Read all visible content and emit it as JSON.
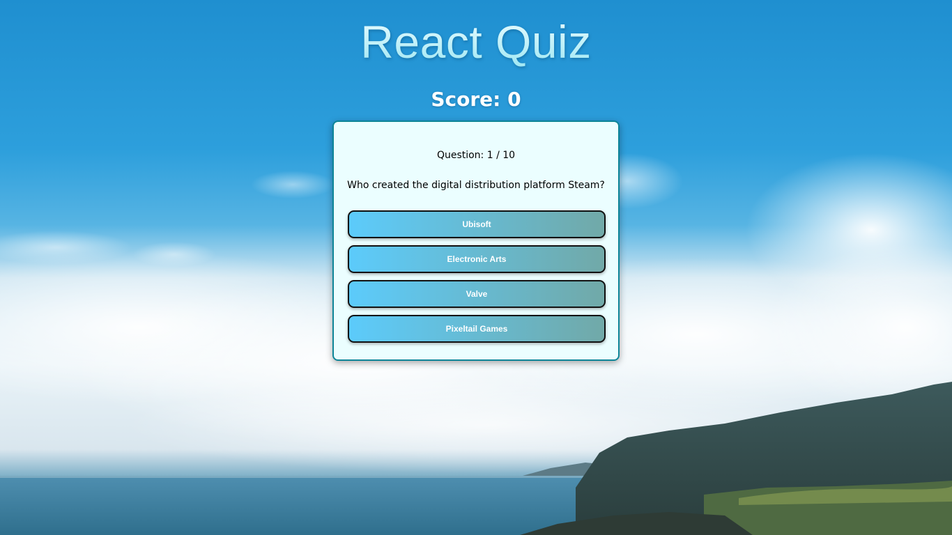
{
  "app": {
    "title": "React Quiz",
    "score_label": "Score: 0"
  },
  "question": {
    "counter": "Question: 1 / 10",
    "text": "Who created the digital distribution platform Steam?"
  },
  "answers": [
    {
      "label": "Ubisoft"
    },
    {
      "label": "Electronic Arts"
    },
    {
      "label": "Valve"
    },
    {
      "label": "Pixeltail Games"
    }
  ],
  "colors": {
    "card_background": "#ebfeff",
    "card_border": "#0d8598",
    "button_gradient_start": "#5ccbfb",
    "button_gradient_end": "#71a9a8"
  }
}
